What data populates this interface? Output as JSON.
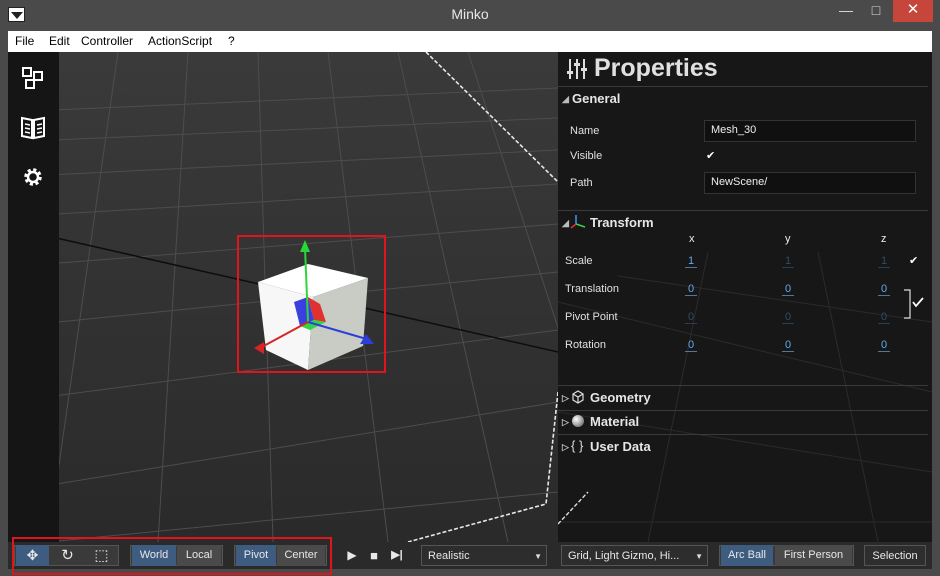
{
  "window": {
    "title": "Minko",
    "controls": {
      "minimize": "—",
      "maximize": "□",
      "close": "✕"
    }
  },
  "menu": [
    "File",
    "Edit",
    "Controller",
    "ActionScript",
    "?"
  ],
  "left_toolbar": [
    {
      "icon": "scene-graph-icon",
      "glyph": "⧉"
    },
    {
      "icon": "library-icon",
      "glyph": "📖"
    },
    {
      "icon": "gear-icon",
      "glyph": "⚙"
    }
  ],
  "properties": {
    "title": "Properties",
    "general": {
      "header": "General",
      "name_label": "Name",
      "name_value": "Mesh_30",
      "visible_label": "Visible",
      "visible_checked": true,
      "path_label": "Path",
      "path_value": "NewScene/"
    },
    "transform": {
      "header": "Transform",
      "axes": [
        "x",
        "y",
        "z"
      ],
      "rows": [
        {
          "label": "Scale",
          "values": [
            "1",
            "1",
            "1"
          ],
          "dim": [
            false,
            true,
            true
          ]
        },
        {
          "label": "Translation",
          "values": [
            "0",
            "0",
            "0"
          ],
          "dim": [
            false,
            false,
            false
          ]
        },
        {
          "label": "Pivot Point",
          "values": [
            "0",
            "0",
            "0"
          ],
          "dim": [
            true,
            true,
            true
          ]
        },
        {
          "label": "Rotation",
          "values": [
            "0",
            "0",
            "0"
          ],
          "dim": [
            false,
            false,
            false
          ]
        }
      ]
    },
    "sections": [
      {
        "header": "Geometry",
        "icon": "cube-icon"
      },
      {
        "header": "Material",
        "icon": "sphere-icon"
      },
      {
        "header": "User Data",
        "icon": "braces-icon"
      }
    ]
  },
  "bottom_bar": {
    "transform_tools": [
      {
        "name": "translate",
        "glyph": "✥",
        "active": true
      },
      {
        "name": "rotate",
        "glyph": "↻",
        "active": false
      },
      {
        "name": "scale",
        "glyph": "⬚",
        "active": false
      }
    ],
    "space": [
      "World",
      "Local"
    ],
    "space_active": "World",
    "origin": [
      "Pivot",
      "Center"
    ],
    "origin_active": "Pivot",
    "playback": {
      "play": "▶",
      "stop": "■",
      "step": "▶|"
    },
    "render_mode": "Realistic",
    "overlays": "Grid, Light Gizmo, Hi...",
    "camera": [
      "Arc Ball",
      "First Person"
    ],
    "camera_active": "Arc Ball",
    "selection": "Selection"
  },
  "colors": {
    "accent": "#3e5b80",
    "highlight_box": "#e0141a",
    "field_value": "#69a6e6"
  }
}
